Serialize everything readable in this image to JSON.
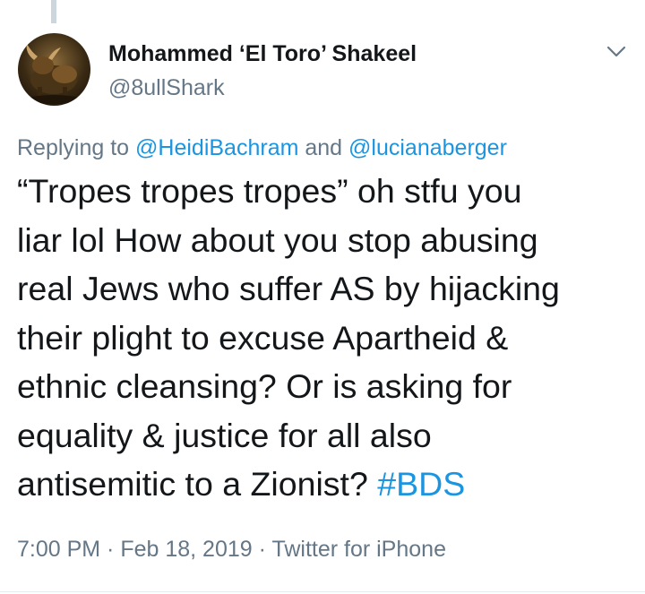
{
  "user": {
    "display_name": "Mohammed ‘El Toro’ Shakeel",
    "handle": "@8ullShark",
    "avatar_icon": "bull-avatar"
  },
  "reply": {
    "prefix": "Replying to ",
    "mention_1": "@HeidiBachram",
    "joiner": " and ",
    "mention_2": "@lucianaberger"
  },
  "tweet": {
    "lines": [
      "“Tropes tropes tropes” oh stfu you",
      "liar lol How about you stop abusing",
      "real Jews who suffer AS by hijacking",
      "their plight to excuse Apartheid &",
      "ethnic cleansing? Or is asking for",
      "equality & justice for all also",
      "antisemitic to a Zionist? "
    ],
    "hashtag": "#BDS"
  },
  "meta": {
    "time": "7:00 PM",
    "sep1": " · ",
    "date": "Feb 18, 2019",
    "sep2": " · ",
    "source": "Twitter for iPhone"
  },
  "colors": {
    "link": "#1b95e0",
    "secondary": "#657786",
    "text": "#14171a"
  },
  "icons": {
    "menu": "chevron-down-icon"
  }
}
